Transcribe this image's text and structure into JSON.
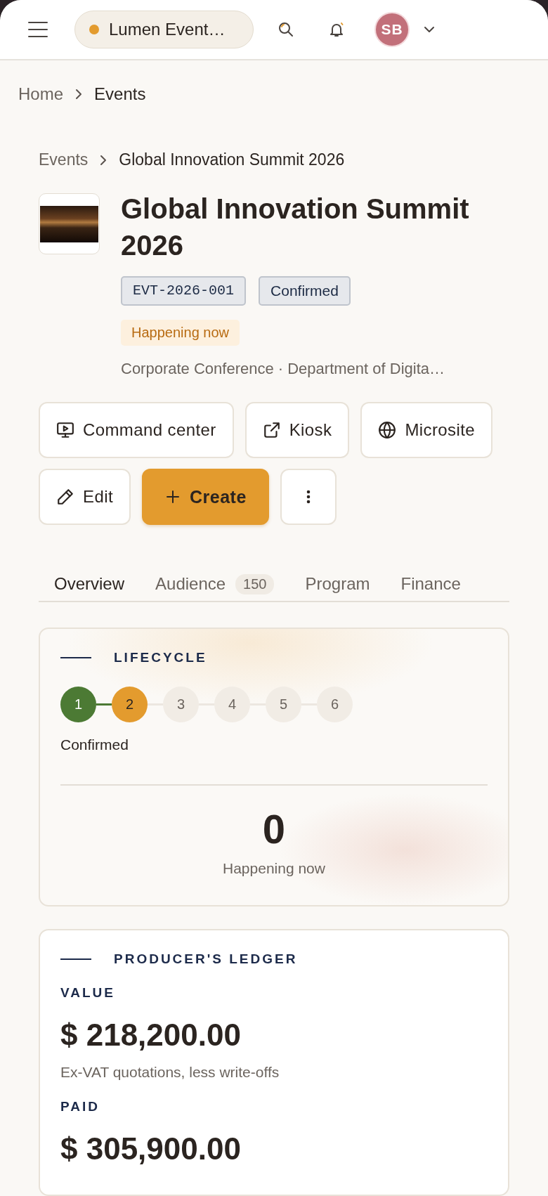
{
  "header": {
    "workspace": "Lumen Event…",
    "avatar_initials": "SB"
  },
  "breadcrumb": [
    {
      "label": "Home",
      "current": false
    },
    {
      "label": "Events",
      "current": true
    }
  ],
  "event": {
    "breadcrumb": [
      {
        "label": "Events",
        "current": false
      },
      {
        "label": "Global Innovation Summit 2026",
        "current": true
      }
    ],
    "title": "Global Innovation Summit 2026",
    "code": "EVT-2026-001",
    "status": "Confirmed",
    "live_badge": "Happening now",
    "subtitle": "Corporate Conference · Department of Digita…"
  },
  "actions": [
    {
      "label": "Command center",
      "kind": "monitor",
      "primary": false
    },
    {
      "label": "Kiosk",
      "kind": "external",
      "primary": false
    },
    {
      "label": "Microsite",
      "kind": "globe",
      "primary": false
    },
    {
      "label": "Edit",
      "kind": "edit",
      "primary": false
    },
    {
      "label": "Create",
      "kind": "create",
      "primary": true
    },
    {
      "kind": "more",
      "primary": false
    }
  ],
  "tabs": [
    {
      "label": "Overview",
      "selected": true
    },
    {
      "label": "Audience",
      "count": "150",
      "selected": false
    },
    {
      "label": "Program",
      "selected": false
    },
    {
      "label": "Finance",
      "selected": false
    }
  ],
  "lifecycle": {
    "title": "LIFECYCLE",
    "steps": [
      {
        "number": "1",
        "kind": "done"
      },
      {
        "number": "2",
        "kind": "current"
      },
      {
        "number": "3",
        "kind": "upcoming"
      },
      {
        "number": "4",
        "kind": "upcoming"
      },
      {
        "number": "5",
        "kind": "upcoming"
      },
      {
        "number": "6",
        "kind": "upcoming"
      }
    ],
    "stage": "Confirmed",
    "stat_value": "0",
    "stat_label": "Happening now"
  },
  "ledger": {
    "title": "PRODUCER'S LEDGER",
    "items": [
      {
        "label": "VALUE",
        "amount": "$ 218,200.00",
        "note": "Ex-VAT quotations, less write-offs"
      },
      {
        "label": "PAID",
        "amount": "$ 305,900.00"
      }
    ]
  }
}
